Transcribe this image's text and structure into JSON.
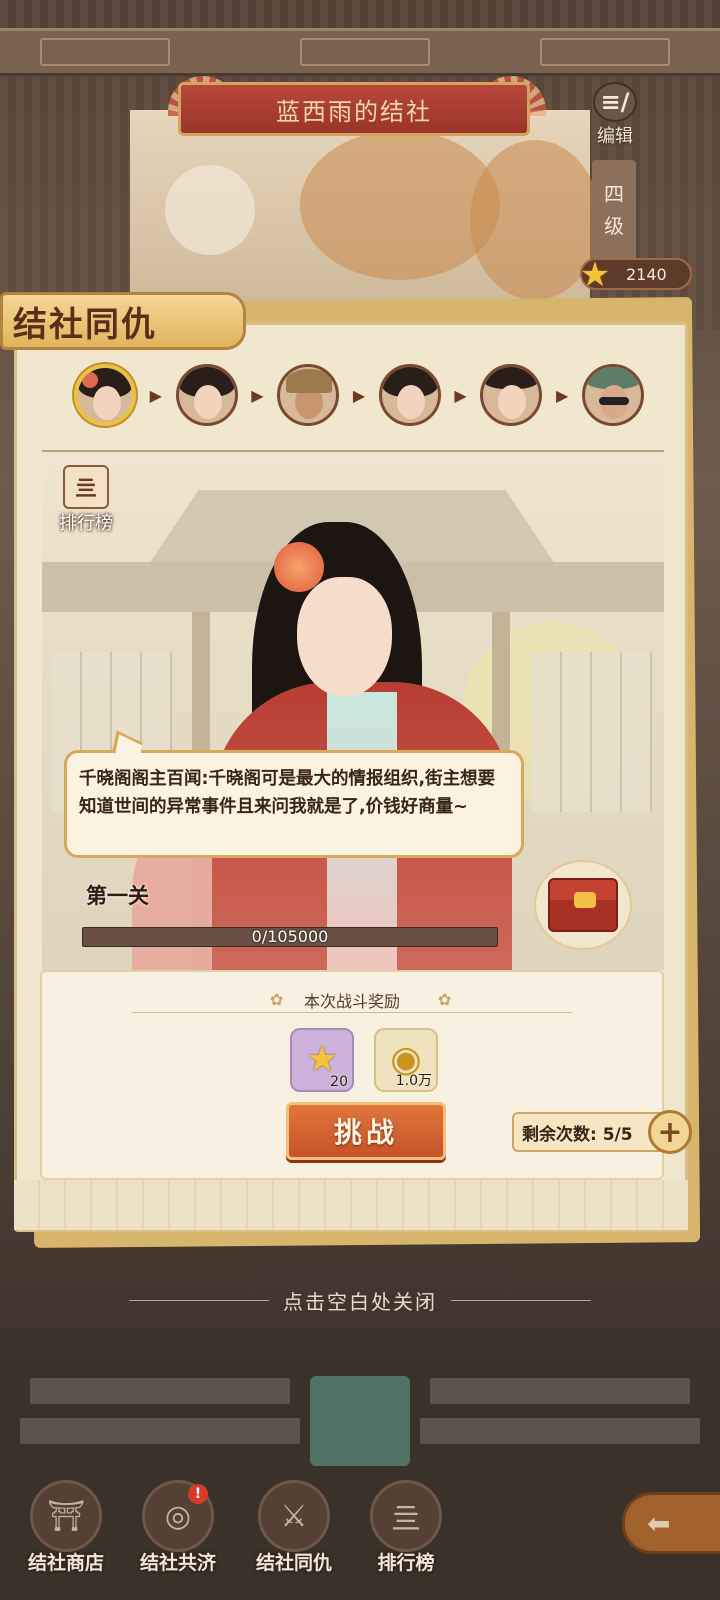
{
  "header": {
    "title": "蓝西雨的结社",
    "edit_label": "编辑",
    "edit_icon": "edit-icon",
    "level_chars": [
      "四",
      "级"
    ],
    "score": "2140"
  },
  "section": {
    "title": "结社同仇"
  },
  "stages": [
    {
      "name": "stage-1",
      "active": true
    },
    {
      "name": "stage-2",
      "active": false
    },
    {
      "name": "stage-3",
      "active": false
    },
    {
      "name": "stage-4",
      "active": false
    },
    {
      "name": "stage-5",
      "active": false
    },
    {
      "name": "stage-6",
      "active": false
    }
  ],
  "leaderboard_label": "排行榜",
  "dialogue": {
    "text": "千晓阁阁主百闻:千晓阁可是最大的情报组织,街主想要知道世间的异常事件且来问我就是了,价钱好商量~"
  },
  "battle": {
    "stage_name": "第一关",
    "hp_text": "0/105000",
    "hp_fraction": 0
  },
  "rewards": {
    "title": "本次战斗奖励",
    "items": [
      {
        "icon": "star-icon",
        "qty": "20"
      },
      {
        "icon": "coin-icon",
        "qty": "1.0万"
      }
    ]
  },
  "actions": {
    "challenge": "挑战",
    "remaining": "剩余次数: 5/5"
  },
  "close_hint": "点击空白处关闭",
  "nav": [
    {
      "label": "结社商店",
      "icon": "shop-icon",
      "badge": ""
    },
    {
      "label": "结社共济",
      "icon": "mutual-aid-icon",
      "badge": "!"
    },
    {
      "label": "结社同仇",
      "icon": "battle-icon",
      "badge": ""
    },
    {
      "label": "排行榜",
      "icon": "leaderboard-icon",
      "badge": ""
    }
  ],
  "colors": {
    "accent": "#c7522a",
    "panel": "#f1e7cf",
    "title_banner": "#9a3529"
  }
}
